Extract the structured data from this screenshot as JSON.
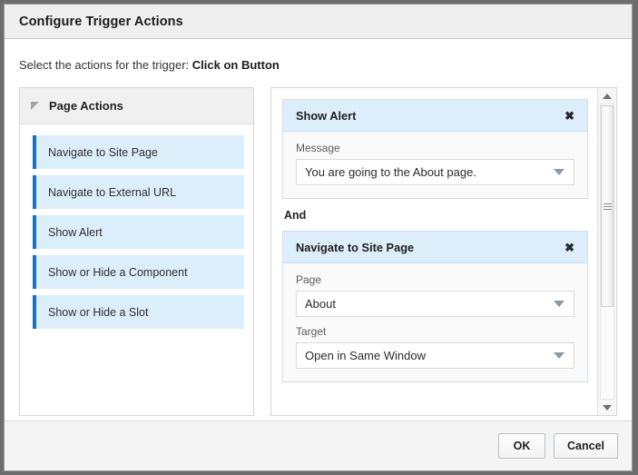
{
  "dialog": {
    "title": "Configure Trigger Actions",
    "instruction_prefix": "Select the actions for the trigger: ",
    "trigger_name": "Click on Button"
  },
  "palette": {
    "header_label": "Page Actions",
    "disclosure_icon": "triangle-expanded-icon",
    "items": [
      {
        "label": "Navigate to Site Page"
      },
      {
        "label": "Navigate to External URL"
      },
      {
        "label": "Show Alert"
      },
      {
        "label": "Show or Hide a Component"
      },
      {
        "label": "Show or Hide a Slot"
      }
    ]
  },
  "actions": {
    "separator_label": "And",
    "close_icon": "✖",
    "caret_icon": "chevron-down-icon",
    "cards": [
      {
        "title": "Show Alert",
        "fields": [
          {
            "label": "Message",
            "value": "You are going to the About page."
          }
        ]
      },
      {
        "title": "Navigate to Site Page",
        "fields": [
          {
            "label": "Page",
            "value": "About"
          },
          {
            "label": "Target",
            "value": "Open in Same Window"
          }
        ]
      }
    ]
  },
  "scrollbar": {
    "up_icon": "arrow-up-icon",
    "down_icon": "arrow-down-icon"
  },
  "footer": {
    "ok_label": "OK",
    "cancel_label": "Cancel"
  },
  "colors": {
    "accent_blue": "#1c70bd",
    "item_blue": "#ddeefb",
    "titlebar_gray": "#efefef"
  }
}
